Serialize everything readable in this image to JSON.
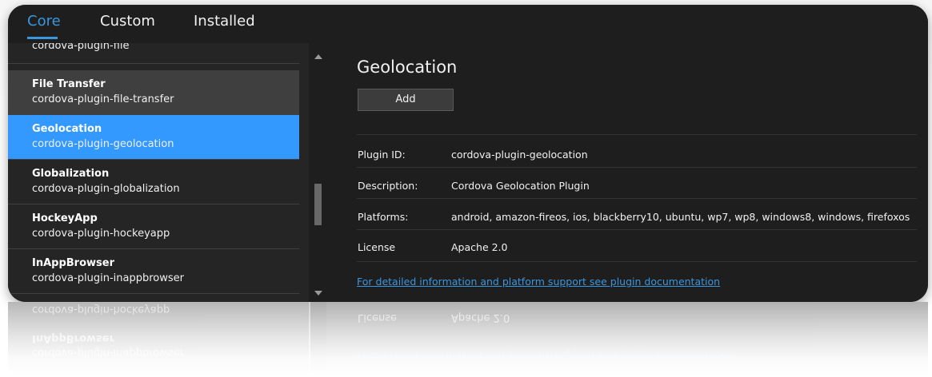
{
  "tabs": [
    {
      "label": "Core",
      "active": true
    },
    {
      "label": "Custom",
      "active": false
    },
    {
      "label": "Installed",
      "active": false
    }
  ],
  "plugins": [
    {
      "name": "",
      "id": "cordova-plugin-file",
      "state": "partial"
    },
    {
      "name": "File Transfer",
      "id": "cordova-plugin-file-transfer",
      "state": "hover"
    },
    {
      "name": "Geolocation",
      "id": "cordova-plugin-geolocation",
      "state": "selected"
    },
    {
      "name": "Globalization",
      "id": "cordova-plugin-globalization",
      "state": "normal"
    },
    {
      "name": "HockeyApp",
      "id": "cordova-plugin-hockeyapp",
      "state": "normal"
    },
    {
      "name": "InAppBrowser",
      "id": "cordova-plugin-inappbrowser",
      "state": "normal"
    }
  ],
  "detail": {
    "title": "Geolocation",
    "add_label": "Add",
    "properties": [
      {
        "label": "Plugin ID:",
        "value": "cordova-plugin-geolocation"
      },
      {
        "label": "Description:",
        "value": "Cordova Geolocation Plugin"
      },
      {
        "label": "Platforms:",
        "value": "android, amazon-fireos, ios, blackberry10, ubuntu, wp7, wp8, windows8, windows, firefoxos"
      },
      {
        "label": "License",
        "value": "Apache 2.0"
      }
    ],
    "doc_link": "For detailed information and platform support see plugin documentation"
  },
  "colors": {
    "accent": "#3a96dd",
    "selected_bg": "#3399ff",
    "background": "#1e1e1e"
  }
}
